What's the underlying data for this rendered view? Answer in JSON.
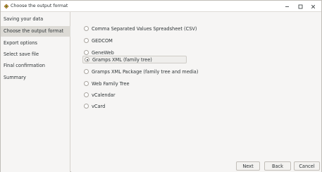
{
  "window": {
    "title": "Choose the output format",
    "icon": "gramps-app-icon",
    "controls": {
      "minimize": "–",
      "maximize": "□",
      "close": "×"
    }
  },
  "sidebar": {
    "items": [
      {
        "label": "Saving your data",
        "active": false
      },
      {
        "label": "Choose the output format",
        "active": true
      },
      {
        "label": "Export options",
        "active": false
      },
      {
        "label": "Select save file",
        "active": false
      },
      {
        "label": "Final confirmation",
        "active": false
      },
      {
        "label": "Summary",
        "active": false
      }
    ]
  },
  "formats": {
    "options": [
      {
        "label": "Comma Separated Values Spreadsheet (CSV)",
        "selected": false
      },
      {
        "label": "GEDCOM",
        "selected": false
      },
      {
        "label": "GeneWeb",
        "selected": false
      },
      {
        "label": "Gramps XML (family tree)",
        "selected": true
      },
      {
        "label": "Gramps XML Package (family tree and media)",
        "selected": false
      },
      {
        "label": "Web Family Tree",
        "selected": false
      },
      {
        "label": "vCalendar",
        "selected": false
      },
      {
        "label": "vCard",
        "selected": false
      }
    ]
  },
  "buttons": {
    "next": "Next",
    "back": "Back",
    "cancel": "Cancel"
  }
}
